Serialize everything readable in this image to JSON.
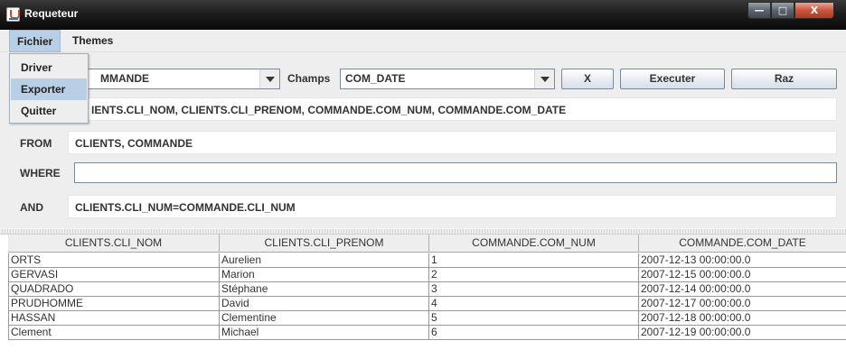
{
  "window": {
    "title": "Requeteur",
    "controls": {
      "minimize": "—",
      "maximize": "□",
      "close": "X"
    }
  },
  "menubar": {
    "items": [
      "Fichier",
      "Themes"
    ]
  },
  "file_menu": {
    "items": [
      "Driver",
      "Exporter",
      "Quitter"
    ],
    "highlighted": "Exporter"
  },
  "query": {
    "table_combo_value": "MMANDE",
    "champs_label": "Champs",
    "champs_combo_value": "COM_DATE",
    "x_button": "X",
    "execute_button": "Executer",
    "raz_button": "Raz",
    "select_text": "IENTS.CLI_NOM, CLIENTS.CLI_PRENOM, COMMANDE.COM_NUM, COMMANDE.COM_DATE",
    "from_label": "FROM",
    "from_text": "CLIENTS, COMMANDE",
    "where_label": "WHERE",
    "where_value": "",
    "and_label": "AND",
    "and_text": "CLIENTS.CLI_NUM=COMMANDE.CLI_NUM"
  },
  "results": {
    "columns": [
      "CLIENTS.CLI_NOM",
      "CLIENTS.CLI_PRENOM",
      "COMMANDE.COM_NUM",
      "COMMANDE.COM_DATE"
    ],
    "rows": [
      [
        "ORTS",
        "Aurelien",
        "1",
        "2007-12-13 00:00:00.0"
      ],
      [
        "GERVASI",
        "Marion",
        "2",
        "2007-12-15 00:00:00.0"
      ],
      [
        "QUADRADO",
        "Stéphane",
        "3",
        "2007-12-14 00:00:00.0"
      ],
      [
        "PRUDHOMME",
        "David",
        "4",
        "2007-12-17 00:00:00.0"
      ],
      [
        "HASSAN",
        "Clementine",
        "5",
        "2007-12-18 00:00:00.0"
      ],
      [
        "Clement",
        "Michael",
        "6",
        "2007-12-19 00:00:00.0"
      ]
    ]
  }
}
